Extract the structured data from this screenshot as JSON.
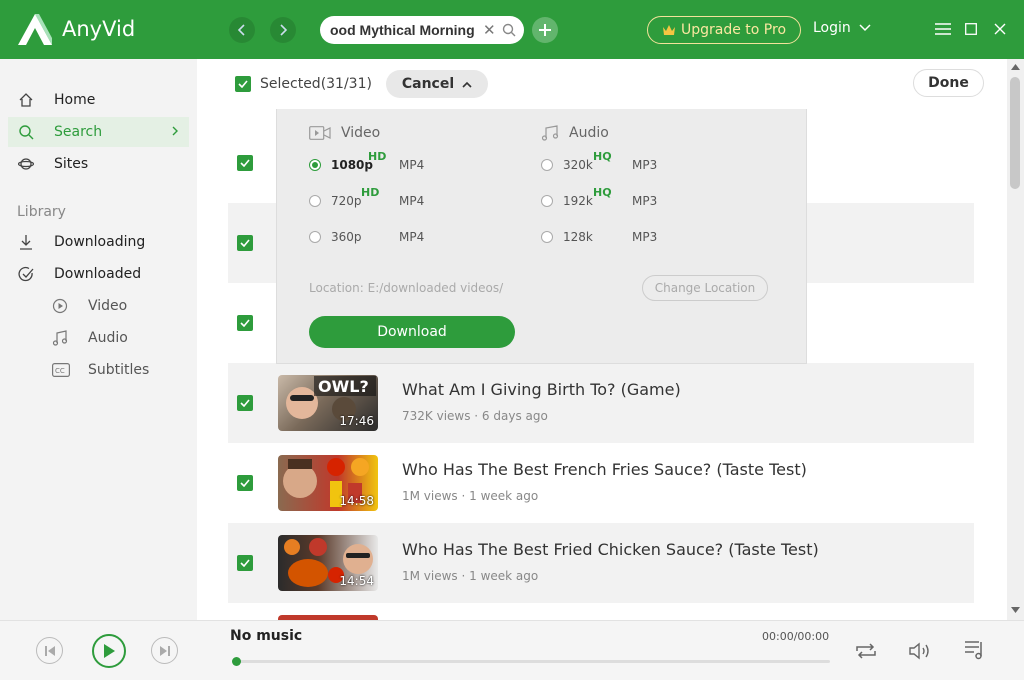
{
  "app": {
    "name": "AnyVid",
    "brand_color": "#2e9c3c"
  },
  "header": {
    "search_value": "ood Mythical Morning",
    "upgrade_label": "Upgrade to Pro",
    "login_label": "Login"
  },
  "sidebar": {
    "home": "Home",
    "search": "Search",
    "sites": "Sites",
    "library_label": "Library",
    "downloading": "Downloading",
    "downloaded": "Downloaded",
    "video": "Video",
    "audio": "Audio",
    "subtitles": "Subtitles"
  },
  "toolbar": {
    "selected_label": "Selected(31/31)",
    "cancel_label": "Cancel",
    "done_label": "Done"
  },
  "panel": {
    "video_heading": "Video",
    "audio_heading": "Audio",
    "video_options": [
      {
        "quality": "1080p",
        "tag": "HD",
        "format": "MP4",
        "selected": true
      },
      {
        "quality": "720p",
        "tag": "HD",
        "format": "MP4",
        "selected": false
      },
      {
        "quality": "360p",
        "tag": "",
        "format": "MP4",
        "selected": false
      }
    ],
    "audio_options": [
      {
        "quality": "320k",
        "tag": "HQ",
        "format": "MP3",
        "selected": false
      },
      {
        "quality": "192k",
        "tag": "HQ",
        "format": "MP3",
        "selected": false
      },
      {
        "quality": "128k",
        "tag": "",
        "format": "MP3",
        "selected": false
      }
    ],
    "location": "Location: E:/downloaded videos/",
    "change_location_label": "Change Location",
    "download_label": "Download"
  },
  "videos": [
    {
      "title": "What Am I Giving Birth To? (Game)",
      "meta": "732K views · 6 days ago",
      "duration": "17:46",
      "badge": "OWL?"
    },
    {
      "title": "Who Has The Best French Fries Sauce? (Taste Test)",
      "meta": "1M views · 1 week ago",
      "duration": "14:58",
      "badge": ""
    },
    {
      "title": "Who Has The Best Fried Chicken Sauce? (Taste Test)",
      "meta": "1M views · 1 week ago",
      "duration": "14:54",
      "badge": ""
    }
  ],
  "player": {
    "now_playing": "No music",
    "time": "00:00/00:00",
    "progress": 0
  }
}
